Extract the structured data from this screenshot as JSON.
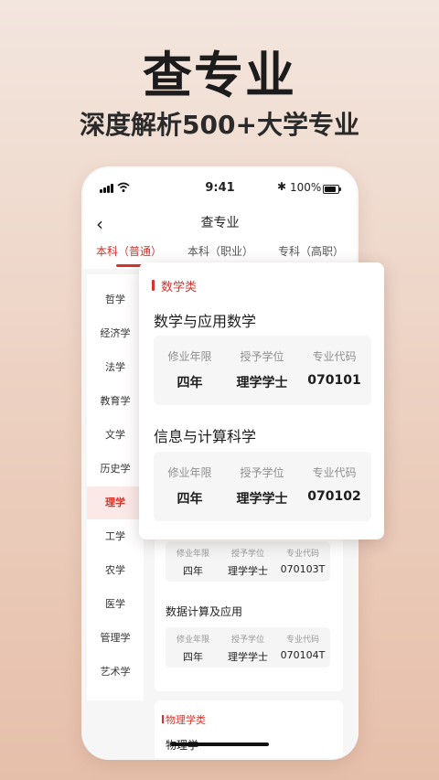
{
  "hero": {
    "title": "查专业",
    "subtitle": "深度解析500+大学专业"
  },
  "status_bar": {
    "time": "9:41",
    "bluetooth": "✱",
    "battery": "100%"
  },
  "nav": {
    "back": "‹",
    "title": "查专业"
  },
  "tabs": [
    {
      "label": "本科（普通）",
      "active": true
    },
    {
      "label": "本科（职业）",
      "active": false
    },
    {
      "label": "专科（高职）",
      "active": false
    }
  ],
  "sidebar": {
    "items": [
      "哲学",
      "经济学",
      "法学",
      "教育学",
      "文学",
      "历史学",
      "理学",
      "工学",
      "农学",
      "医学",
      "管理学",
      "艺术学"
    ],
    "active_index": 6
  },
  "labels": {
    "years": "修业年限",
    "degree": "授予学位",
    "code": "专业代码"
  },
  "list": {
    "majors": [
      {
        "name": "",
        "years": "四年",
        "degree": "理学学士",
        "code": "070103T"
      },
      {
        "name": "数据计算及应用",
        "years": "四年",
        "degree": "理学学士",
        "code": "070104T"
      }
    ],
    "next_category": "物理学类",
    "next_major": "物理学"
  },
  "popup": {
    "category": "数学类",
    "majors": [
      {
        "name": "数学与应用数学",
        "years": "四年",
        "degree": "理学学士",
        "code": "070101"
      },
      {
        "name": "信息与计算科学",
        "years": "四年",
        "degree": "理学学士",
        "code": "070102"
      }
    ]
  },
  "colors": {
    "accent": "#d7332a"
  }
}
